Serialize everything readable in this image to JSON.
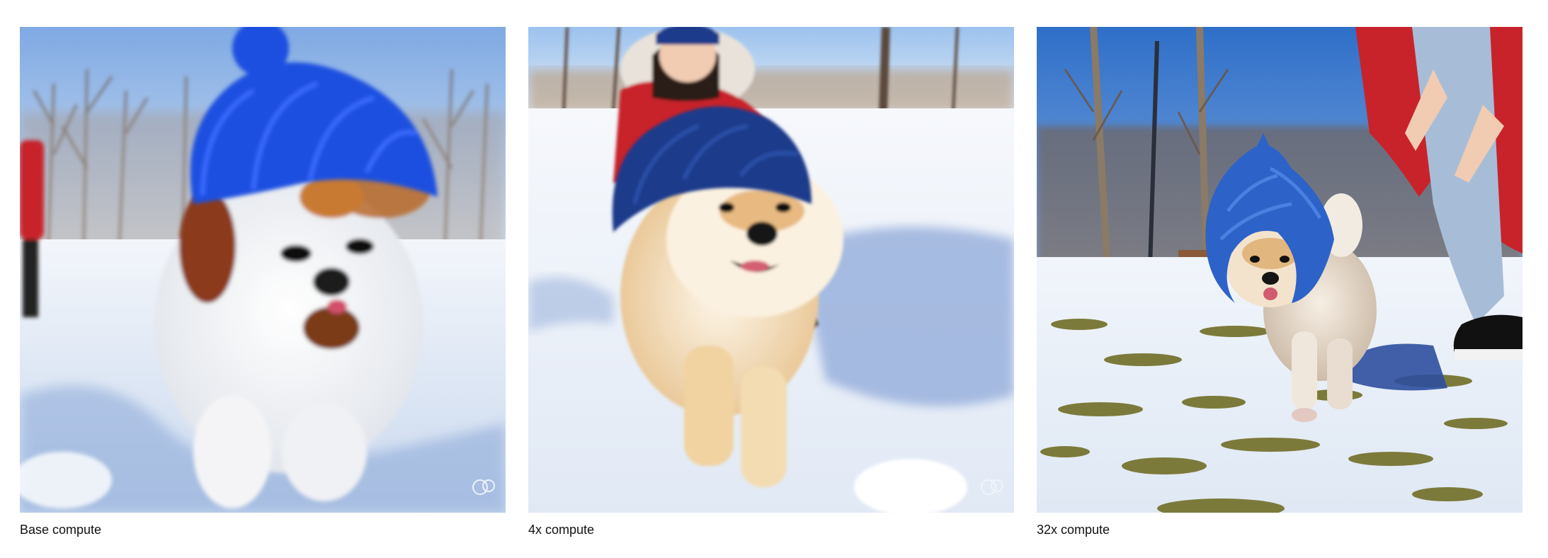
{
  "panels": [
    {
      "caption": "Base compute",
      "scene": "fluffy white-and-brown puppy wearing a bright blue knit beanie running through snow, blurry and distorted"
    },
    {
      "caption": "4x compute",
      "scene": "shiba inu puppy in a navy knit hat running on snow with a woman in a red jacket behind it"
    },
    {
      "caption": "32x compute",
      "scene": "shiba puppy in a blue knit hood walking across patchy snow and grass beside a person in red coat and jeans"
    }
  ],
  "colors": {
    "hat_bright_blue": "#1f4fe0",
    "hat_navy": "#1d3a8a",
    "hat_blue_knit": "#2d63c8",
    "snow": "#eef3fb",
    "snow_shadow": "#9fb6dd",
    "sky": "#8fb8ea",
    "jacket_red": "#c8232b",
    "grass": "#7c7a3a"
  }
}
